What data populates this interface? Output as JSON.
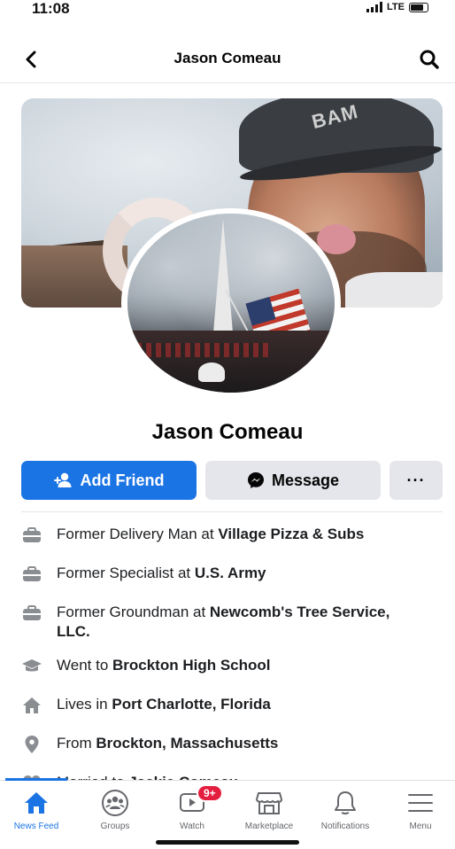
{
  "status_bar": {
    "time": "11:08",
    "network": "LTE"
  },
  "header": {
    "title": "Jason Comeau"
  },
  "profile": {
    "name": "Jason Comeau"
  },
  "actions": {
    "add_friend": "Add Friend",
    "message": "Message",
    "more": "···"
  },
  "details": [
    {
      "icon": "briefcase-icon",
      "prefix": "Former Delivery Man at ",
      "bold": "Village Pizza & Subs"
    },
    {
      "icon": "briefcase-icon",
      "prefix": "Former Specialist at ",
      "bold": "U.S. Army"
    },
    {
      "icon": "briefcase-icon",
      "prefix": "Former Groundman at ",
      "bold": "Newcomb's Tree Service, LLC."
    },
    {
      "icon": "graduation-cap-icon",
      "prefix": "Went to ",
      "bold": "Brockton High School"
    },
    {
      "icon": "house-icon",
      "prefix": "Lives in ",
      "bold": "Port Charlotte, Florida"
    },
    {
      "icon": "location-pin-icon",
      "prefix": "From ",
      "bold": "Brockton, Massachusetts"
    },
    {
      "icon": "heart-icon",
      "prefix": "Married to ",
      "bold": "Jackie Comeau"
    }
  ],
  "tabbar": {
    "tabs": [
      {
        "label": "News Feed",
        "icon": "home-icon",
        "active": true
      },
      {
        "label": "Groups",
        "icon": "groups-icon"
      },
      {
        "label": "Watch",
        "icon": "watch-icon",
        "badge": "9+"
      },
      {
        "label": "Marketplace",
        "icon": "marketplace-icon"
      },
      {
        "label": "Notifications",
        "icon": "bell-icon"
      },
      {
        "label": "Menu",
        "icon": "menu-icon"
      }
    ]
  },
  "colors": {
    "accent": "#1b74e4",
    "secondary_button": "#e4e6eb",
    "badge": "#e41e3f",
    "text_muted": "#65676b"
  }
}
